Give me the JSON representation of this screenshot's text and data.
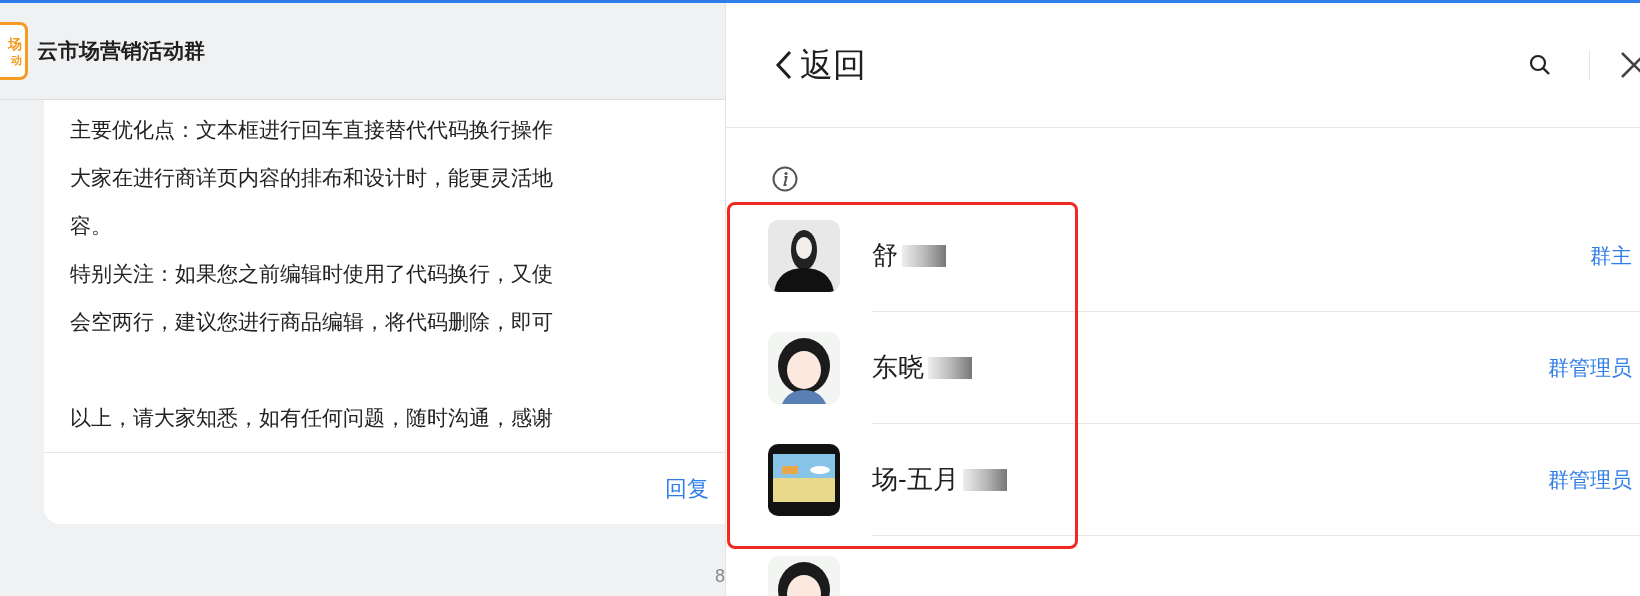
{
  "chat": {
    "logo_text": [
      "场",
      "动"
    ],
    "title": "云市场营销活动群",
    "paragraphs": [
      [
        "主要优化点：文本框进行回车直接替代代码换行操作",
        "大家在进行商详页内容的排布和设计时，能更灵活地",
        "容。",
        "特别关注：如果您之前编辑时使用了代码换行，又使",
        "会空两行，建议您进行商品编辑，将代码删除，即可"
      ],
      [
        "以上，请大家知悉，如有任何问题，随时沟通，感谢"
      ]
    ],
    "reply": "回复",
    "count": "8"
  },
  "panel": {
    "back": "返回",
    "members": [
      {
        "name": "舒",
        "role": "群主",
        "masked": true
      },
      {
        "name": "东晓",
        "role": "群管理员",
        "masked": true
      },
      {
        "name": "场-五月",
        "role": "群管理员",
        "masked": true
      },
      {
        "masked": false
      }
    ]
  }
}
